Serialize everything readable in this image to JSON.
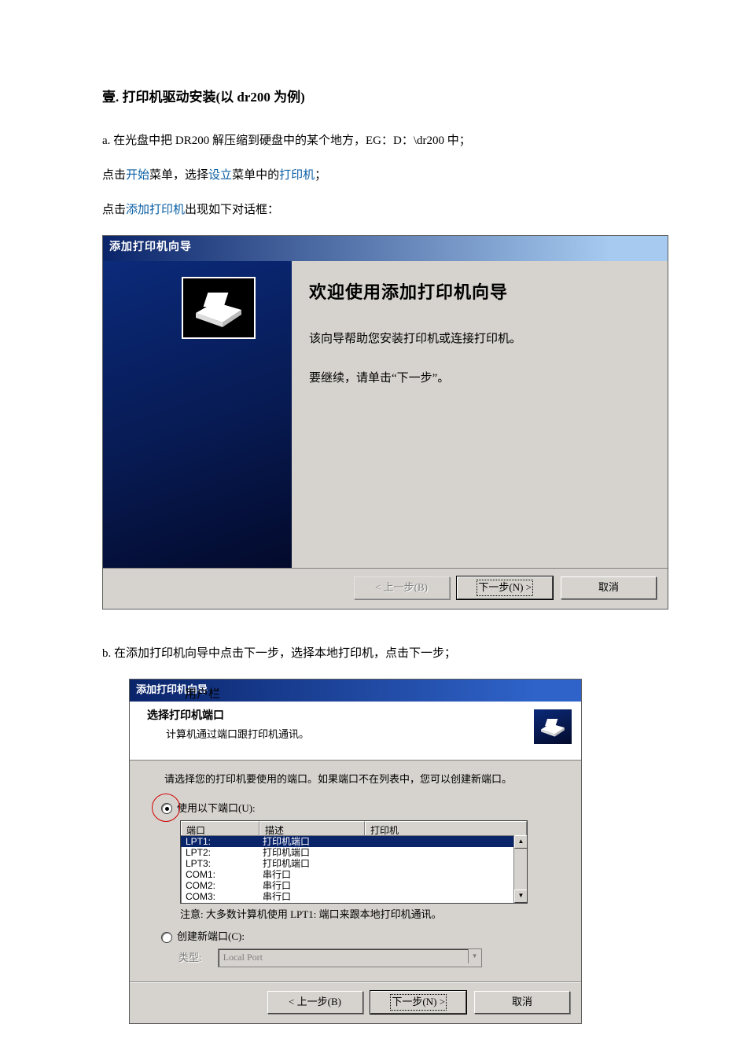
{
  "doc": {
    "heading": "壹.  打印机驱动安装(以 dr200 为例)",
    "p_a": "a. 在光盘中把 DR200 解压缩到硬盘中的某个地方，EG：D：\\dr200 中；",
    "p2_pre": "点击",
    "p2_l1": "开始",
    "p2_mid1": "菜单，选择",
    "p2_l2": "设立",
    "p2_mid2": "菜单中的",
    "p2_l3": "打印机",
    "p2_end": "；",
    "p3_pre": "点击",
    "p3_l1": "添加打印机",
    "p3_end": "出现如下对话框：",
    "p_b": "b. 在添加打印机向导中点击下一步，选择本地打印机，点击下一步；",
    "side_label": "用户栏"
  },
  "dlg1": {
    "title": "添加打印机向导",
    "welcome": "欢迎使用添加打印机向导",
    "line1": "该向导帮助您安装打印机或连接打印机。",
    "line2": "要继续，请单击“下一步”。",
    "btn_back": "< 上一步(B)",
    "btn_next": "下一步(N) >",
    "btn_cancel": "取消"
  },
  "dlg2": {
    "title": "添加打印机向导",
    "head_title": "选择打印机端口",
    "head_sub": "计算机通过端口跟打印机通讯。",
    "instr": "请选择您的打印机要使用的端口。如果端口不在列表中，您可以创建新端口。",
    "radio1": "使用以下端口(U):",
    "cols": {
      "port": "端口",
      "desc": "描述",
      "printer": "打印机"
    },
    "rows": [
      {
        "port": "LPT1:",
        "desc": "打印机端口",
        "selected": true
      },
      {
        "port": "LPT2:",
        "desc": "打印机端口",
        "selected": false
      },
      {
        "port": "LPT3:",
        "desc": "打印机端口",
        "selected": false
      },
      {
        "port": "COM1:",
        "desc": "串行口",
        "selected": false
      },
      {
        "port": "COM2:",
        "desc": "串行口",
        "selected": false
      },
      {
        "port": "COM3:",
        "desc": "串行口",
        "selected": false
      }
    ],
    "note": "注意:  大多数计算机使用 LPT1: 端口来跟本地打印机通讯。",
    "radio2": "创建新端口(C):",
    "type_label": "类型:",
    "type_value": "Local Port",
    "btn_back": "< 上一步(B)",
    "btn_next": "下一步(N) >",
    "btn_cancel": "取消"
  }
}
